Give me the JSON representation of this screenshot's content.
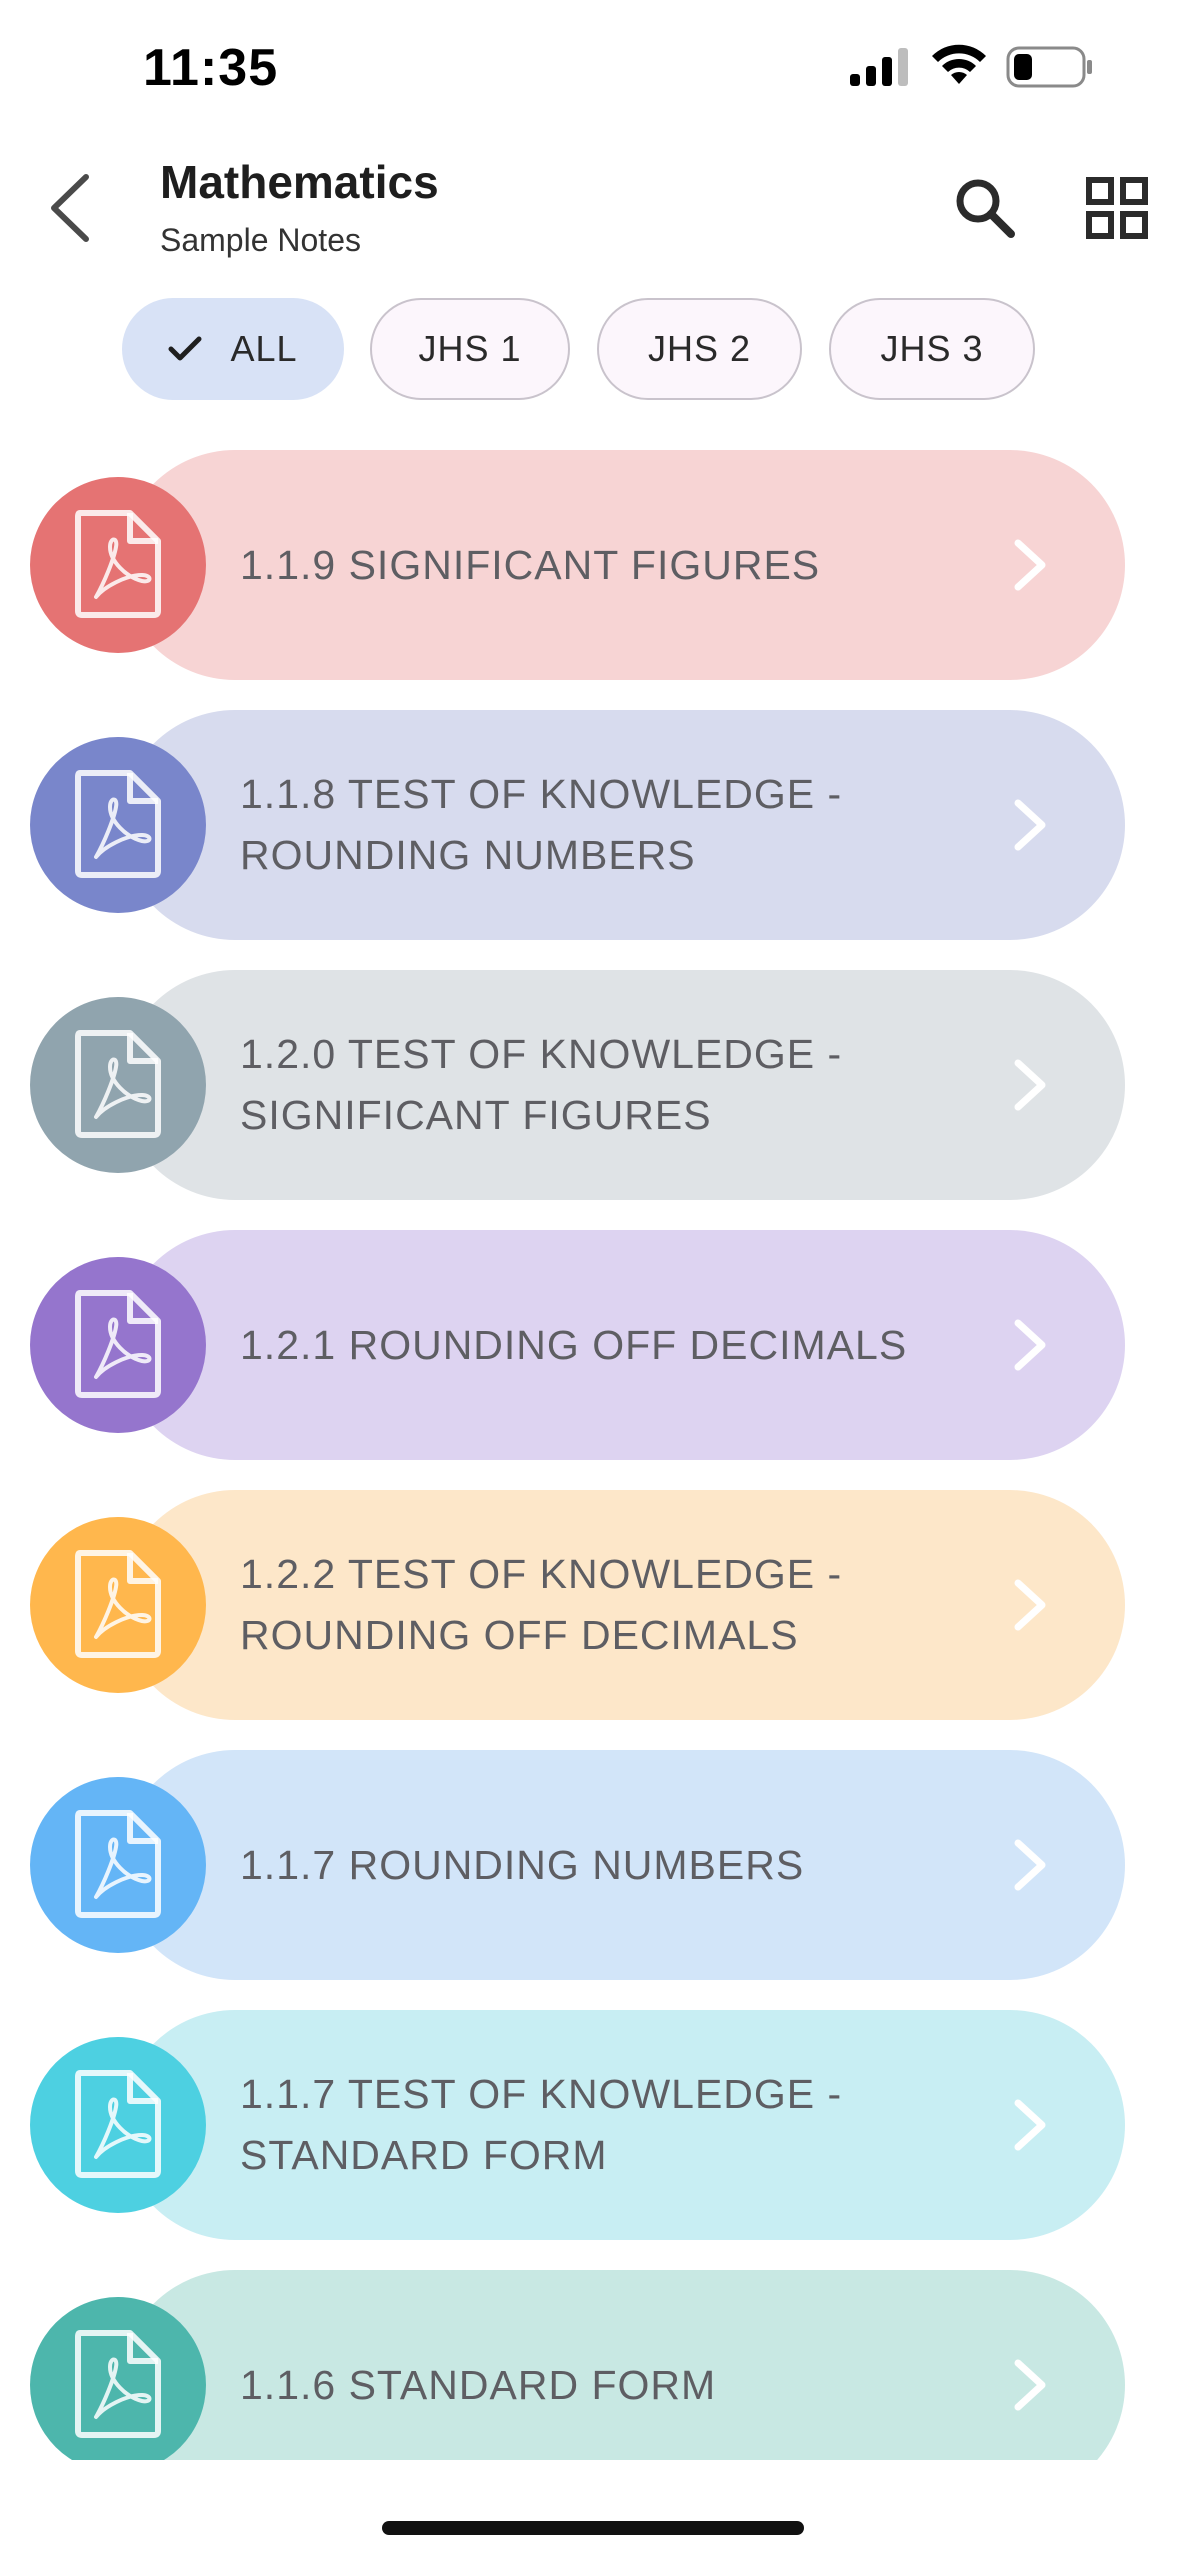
{
  "status_bar": {
    "time": "11:35",
    "signal_icon": "cellular-signal-icon",
    "wifi_icon": "wifi-icon",
    "battery_icon": "battery-icon"
  },
  "header": {
    "back_icon": "chevron-left-icon",
    "title": "Mathematics",
    "subtitle": "Sample Notes",
    "search_icon": "search-icon",
    "view_toggle_icon": "grid-view-icon"
  },
  "filters": {
    "selected": "ALL",
    "chips": [
      {
        "label": "ALL",
        "selected": true
      },
      {
        "label": "JHS 1",
        "selected": false
      },
      {
        "label": "JHS 2",
        "selected": false
      },
      {
        "label": "JHS 3",
        "selected": false
      }
    ]
  },
  "documents": [
    {
      "title": "1.1.9 SIGNIFICANT FIGURES",
      "icon": "pdf-file-icon",
      "accent": "#e57373",
      "background": "#f7d4d4"
    },
    {
      "title": "1.1.8 TEST OF KNOWLEDGE - ROUNDING NUMBERS",
      "icon": "pdf-file-icon",
      "accent": "#7986cb",
      "background": "#d7dbee"
    },
    {
      "title": "1.2.0 TEST OF KNOWLEDGE - SIGNIFICANT FIGURES",
      "icon": "pdf-file-icon",
      "accent": "#90a4ae",
      "background": "#dfe3e6"
    },
    {
      "title": "1.2.1 ROUNDING OFF DECIMALS",
      "icon": "pdf-file-icon",
      "accent": "#9575cd",
      "background": "#ddd3f1"
    },
    {
      "title": "1.2.2 TEST OF KNOWLEDGE - ROUNDING OFF DECIMALS",
      "icon": "pdf-file-icon",
      "accent": "#ffb74d",
      "background": "#fde7c9"
    },
    {
      "title": "1.1.7 ROUNDING NUMBERS",
      "icon": "pdf-file-icon",
      "accent": "#64b5f6",
      "background": "#d2e5f9"
    },
    {
      "title": "1.1.7 TEST OF KNOWLEDGE - STANDARD FORM",
      "icon": "pdf-file-icon",
      "accent": "#4dd0e1",
      "background": "#c8eef3"
    },
    {
      "title": "1.1.6 STANDARD FORM",
      "icon": "pdf-file-icon",
      "accent": "#4db6ac",
      "background": "#c8e8e3"
    }
  ],
  "chevron_icon": "chevron-right-icon"
}
